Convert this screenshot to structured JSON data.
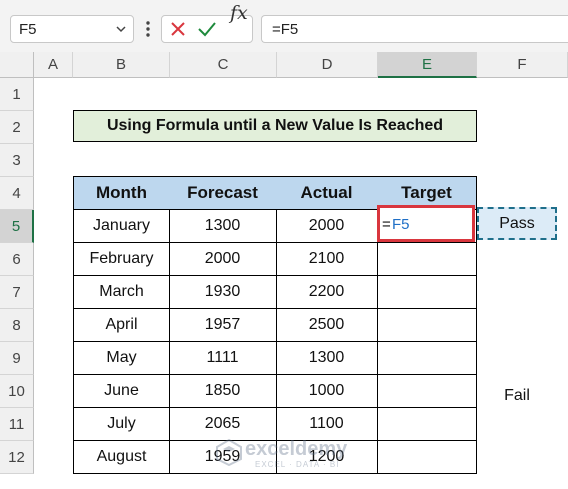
{
  "formula_bar": {
    "name_box": "F5",
    "formula": "=F5",
    "fx_label": "fx"
  },
  "columns": [
    "A",
    "B",
    "C",
    "D",
    "E",
    "F"
  ],
  "selected_column": "E",
  "rows": [
    "1",
    "2",
    "3",
    "4",
    "5",
    "6",
    "7",
    "8",
    "9",
    "10",
    "11",
    "12"
  ],
  "selected_row": "5",
  "title": "Using Formula until a New Value Is Reached",
  "table": {
    "headers": [
      "Month",
      "Forecast",
      "Actual",
      "Target"
    ],
    "rows": [
      [
        "January",
        "1300",
        "2000",
        ""
      ],
      [
        "February",
        "2000",
        "2100",
        ""
      ],
      [
        "March",
        "1930",
        "2200",
        ""
      ],
      [
        "April",
        "1957",
        "2500",
        ""
      ],
      [
        "May",
        "1111",
        "1300",
        ""
      ],
      [
        "June",
        "1850",
        "1000",
        ""
      ],
      [
        "July",
        "2065",
        "1100",
        ""
      ],
      [
        "August",
        "1959",
        "1200",
        ""
      ]
    ]
  },
  "active_cell": {
    "eq": "=",
    "ref": "F5"
  },
  "ref_cell_value": "Pass",
  "fail_value": "Fail",
  "watermark": {
    "name": "exceldemy",
    "tagline": "EXCEL · DATA · BI"
  },
  "colors": {
    "header_fill": "#bdd7ee",
    "title_fill": "#e2efda",
    "active_border": "#d9363e",
    "ref_fill": "#dcebf7",
    "excel_green": "#1e7145"
  }
}
